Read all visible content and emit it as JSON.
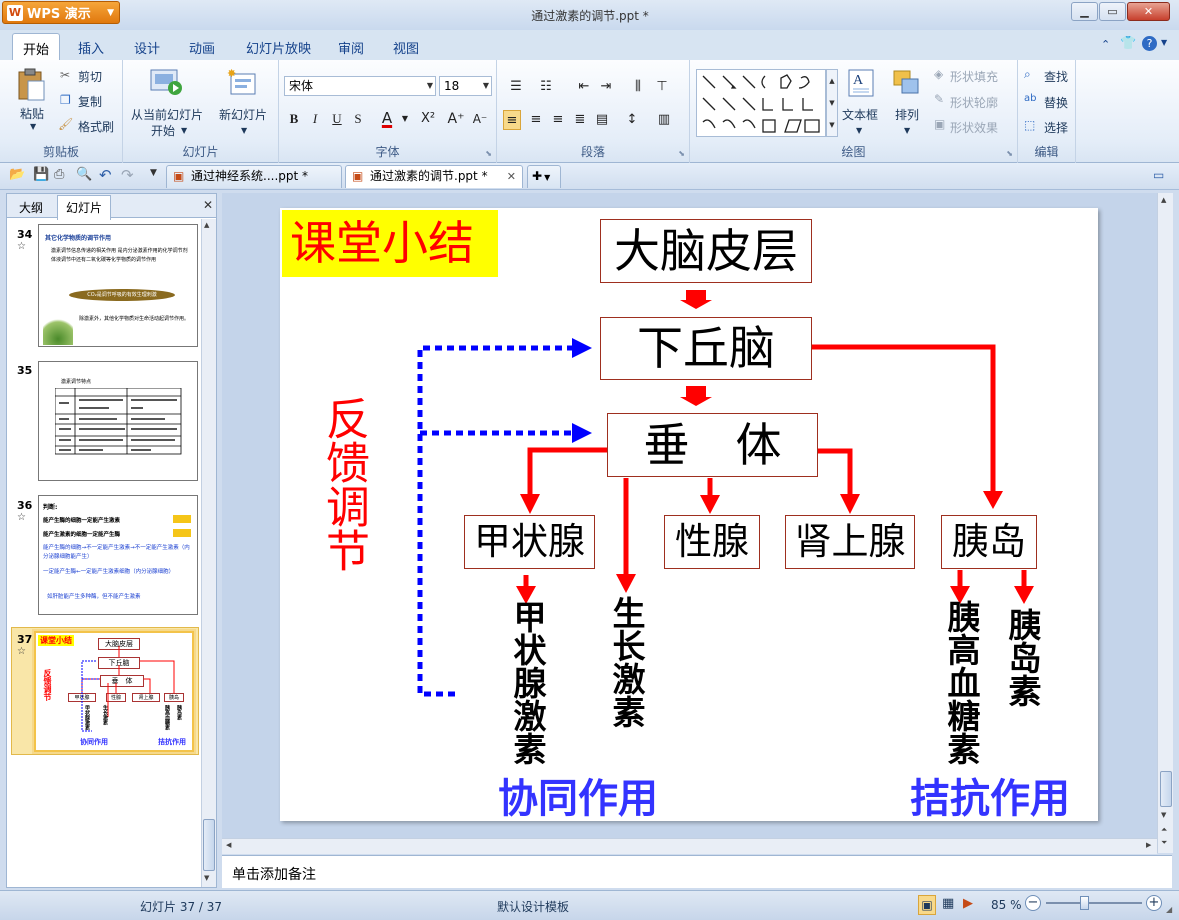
{
  "app": {
    "button_label": "WPS 演示",
    "logo_glyph": "W",
    "title": "通过激素的调节.ppt *"
  },
  "ribbon_tabs": [
    "开始",
    "插入",
    "设计",
    "动画",
    "幻灯片放映",
    "审阅",
    "视图"
  ],
  "ribbon": {
    "clipboard": {
      "paste": "粘贴",
      "cut": "剪切",
      "copy": "复制",
      "format_painter": "格式刷",
      "label": "剪贴板"
    },
    "slides": {
      "from_current": "从当前幻灯片",
      "start": "开始",
      "new_slide": "新幻灯片",
      "label": "幻灯片"
    },
    "font": {
      "name": "宋体",
      "size": "18",
      "label": "字体",
      "bold": "B",
      "italic": "I",
      "underline": "U",
      "shadow": "S"
    },
    "paragraph": {
      "label": "段落"
    },
    "drawing": {
      "textbox": "文本框",
      "arrange": "排列",
      "shape_fill": "形状填充",
      "shape_outline": "形状轮廓",
      "shape_effect": "形状效果",
      "label": "绘图"
    },
    "edit": {
      "find": "查找",
      "replace": "替换",
      "select": "选择",
      "label": "编辑"
    }
  },
  "doc_tabs": [
    {
      "label": "通过神经系统....ppt *",
      "active": false
    },
    {
      "label": "通过激素的调节.ppt *",
      "active": true
    }
  ],
  "left_pane": {
    "tabs": [
      "大纲",
      "幻灯片"
    ],
    "thumbnails": [
      {
        "num": "34",
        "star": "☆"
      },
      {
        "num": "35",
        "star": ""
      },
      {
        "num": "36",
        "star": "☆"
      },
      {
        "num": "37",
        "star": "☆"
      }
    ],
    "thumb34": {
      "title": "其它化学物质的调节作用",
      "body": "激素调节信息传递的相关作用 是内分泌激素作用的化学调节剂 体液调节中还有二氧化碳等化学物质的调节作用",
      "pill": "CO₂是调节呼吸的有效生理刺激",
      "foot": "除激素外，其他化学物质对生命活动起调节作用。"
    },
    "thumb35": {
      "title": "激素调节特点"
    },
    "thumb36": {
      "title": "判断:",
      "l1": "能产生酶的细胞一定能产生激素",
      "l2": "能产生激素的细胞一定能产生酶",
      "l3": "能产生酶的细胞→不一定能产生激素→不一定能产生激素（内分泌腺细胞能产生）",
      "l4": "一定能产生酶←一定能产生激素细胞（内分泌腺细胞）",
      "l5": "如肝脏能产生多种酶，但不能产生激素"
    }
  },
  "slide": {
    "title": "课堂小结",
    "feedback": "反馈调节",
    "cortex": "大脑皮层",
    "hypothalamus": "下丘脑",
    "pituitary": "垂　体",
    "thyroid": "甲状腺",
    "gonad": "性腺",
    "adrenal": "肾上腺",
    "islet": "胰岛",
    "thyroxine": "甲状腺激素",
    "growth": "生长激素",
    "glucagon": "胰高血糖素",
    "insulin": "胰岛素",
    "synergy": "协同作用",
    "antagonism": "拮抗作用"
  },
  "notes_placeholder": "单击添加备注",
  "status": {
    "slide_counter": "幻灯片 37 / 37",
    "template": "默认设计模板",
    "zoom": "85 %"
  },
  "colors": {
    "accent_red": "#ff0000",
    "feedback_blue": "#0000ff",
    "label_blue": "#3333ff",
    "title_bg": "#ffff00"
  }
}
